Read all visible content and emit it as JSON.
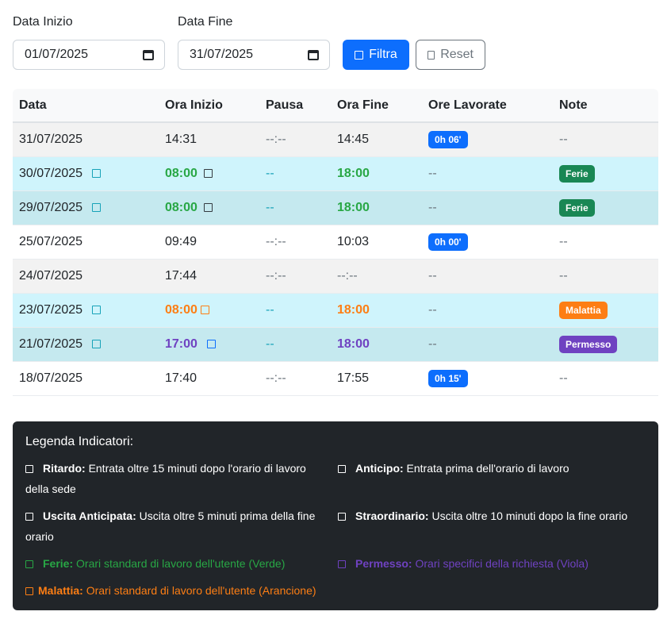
{
  "filters": {
    "start_label": "Data Inizio",
    "start_value": "01/07/2025",
    "end_label": "Data Fine",
    "end_value": "31/07/2025",
    "filter_label": "Filtra",
    "reset_label": "Reset"
  },
  "table": {
    "headers": [
      "Data",
      "Ora Inizio",
      "Pausa",
      "Ora Fine",
      "Ore Lavorate",
      "Note"
    ],
    "rows": [
      {
        "date": "31/07/2025",
        "start": "14:31",
        "pause": "--:--",
        "end": "14:45",
        "worked": "0h 06'",
        "note": "--"
      },
      {
        "date": "30/07/2025",
        "start": "08:00",
        "pause": "--",
        "end": "18:00",
        "worked": "--",
        "note": "Ferie"
      },
      {
        "date": "29/07/2025",
        "start": "08:00",
        "pause": "--",
        "end": "18:00",
        "worked": "--",
        "note": "Ferie"
      },
      {
        "date": "25/07/2025",
        "start": "09:49",
        "pause": "--:--",
        "end": "10:03",
        "worked": "0h 00'",
        "note": "--"
      },
      {
        "date": "24/07/2025",
        "start": "17:44",
        "pause": "--:--",
        "end": "--:--",
        "worked": "--",
        "note": "--"
      },
      {
        "date": "23/07/2025",
        "start": "08:00",
        "pause": "--",
        "end": "18:00",
        "worked": "--",
        "note": "Malattia"
      },
      {
        "date": "21/07/2025",
        "start": "17:00",
        "pause": "--",
        "end": "18:00",
        "worked": "--",
        "note": "Permesso"
      },
      {
        "date": "18/07/2025",
        "start": "17:40",
        "pause": "--:--",
        "end": "17:55",
        "worked": "0h 15'",
        "note": "--"
      }
    ]
  },
  "legend": {
    "title": "Legenda Indicatori:",
    "items": [
      {
        "term": "Ritardo:",
        "desc": "Entrata oltre 15 minuti dopo l'orario di lavoro della sede"
      },
      {
        "term": "Anticipo:",
        "desc": "Entrata prima dell'orario di lavoro"
      },
      {
        "term": "Uscita Anticipata:",
        "desc": "Uscita oltre 5 minuti prima della fine orario"
      },
      {
        "term": "Straordinario:",
        "desc": "Uscita oltre 10 minuti dopo la fine orario"
      },
      {
        "term": "Ferie:",
        "desc": "Orari standard di lavoro dell'utente (Verde)"
      },
      {
        "term": "Permesso:",
        "desc": "Orari specifici della richiesta (Viola)"
      },
      {
        "term": "Malattia:",
        "desc": "Orari standard di lavoro dell'utente (Arancione)"
      }
    ]
  },
  "colors": {
    "primary": "#0d6efd",
    "ferie": "#28a745",
    "malattia": "#fd7e14",
    "permesso": "#6f42c1",
    "anticipo": "#17a2b8",
    "ritardo": "#dc3545",
    "legend_bg": "#212529"
  },
  "icons": {
    "date_picker": "calendar-icon",
    "filter": "square-icon",
    "reset": "square-icon",
    "indicator": "square-indicator-icon"
  }
}
